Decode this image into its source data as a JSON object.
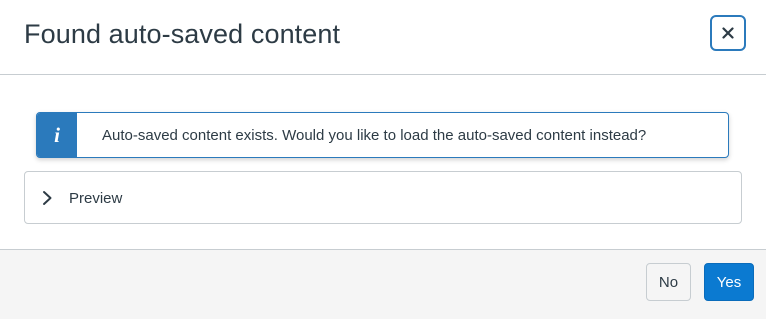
{
  "modal": {
    "title": "Found auto-saved content",
    "close_icon": "close-icon"
  },
  "alert": {
    "icon": "info-icon",
    "icon_glyph": "i",
    "message": "Auto-saved content exists. Would you like to load the auto-saved content instead?",
    "accent_color": "#2b7abc"
  },
  "preview": {
    "icon": "chevron-right-icon",
    "label": "Preview"
  },
  "footer": {
    "no_label": "No",
    "yes_label": "Yes",
    "primary_color": "#0b7ad1"
  }
}
